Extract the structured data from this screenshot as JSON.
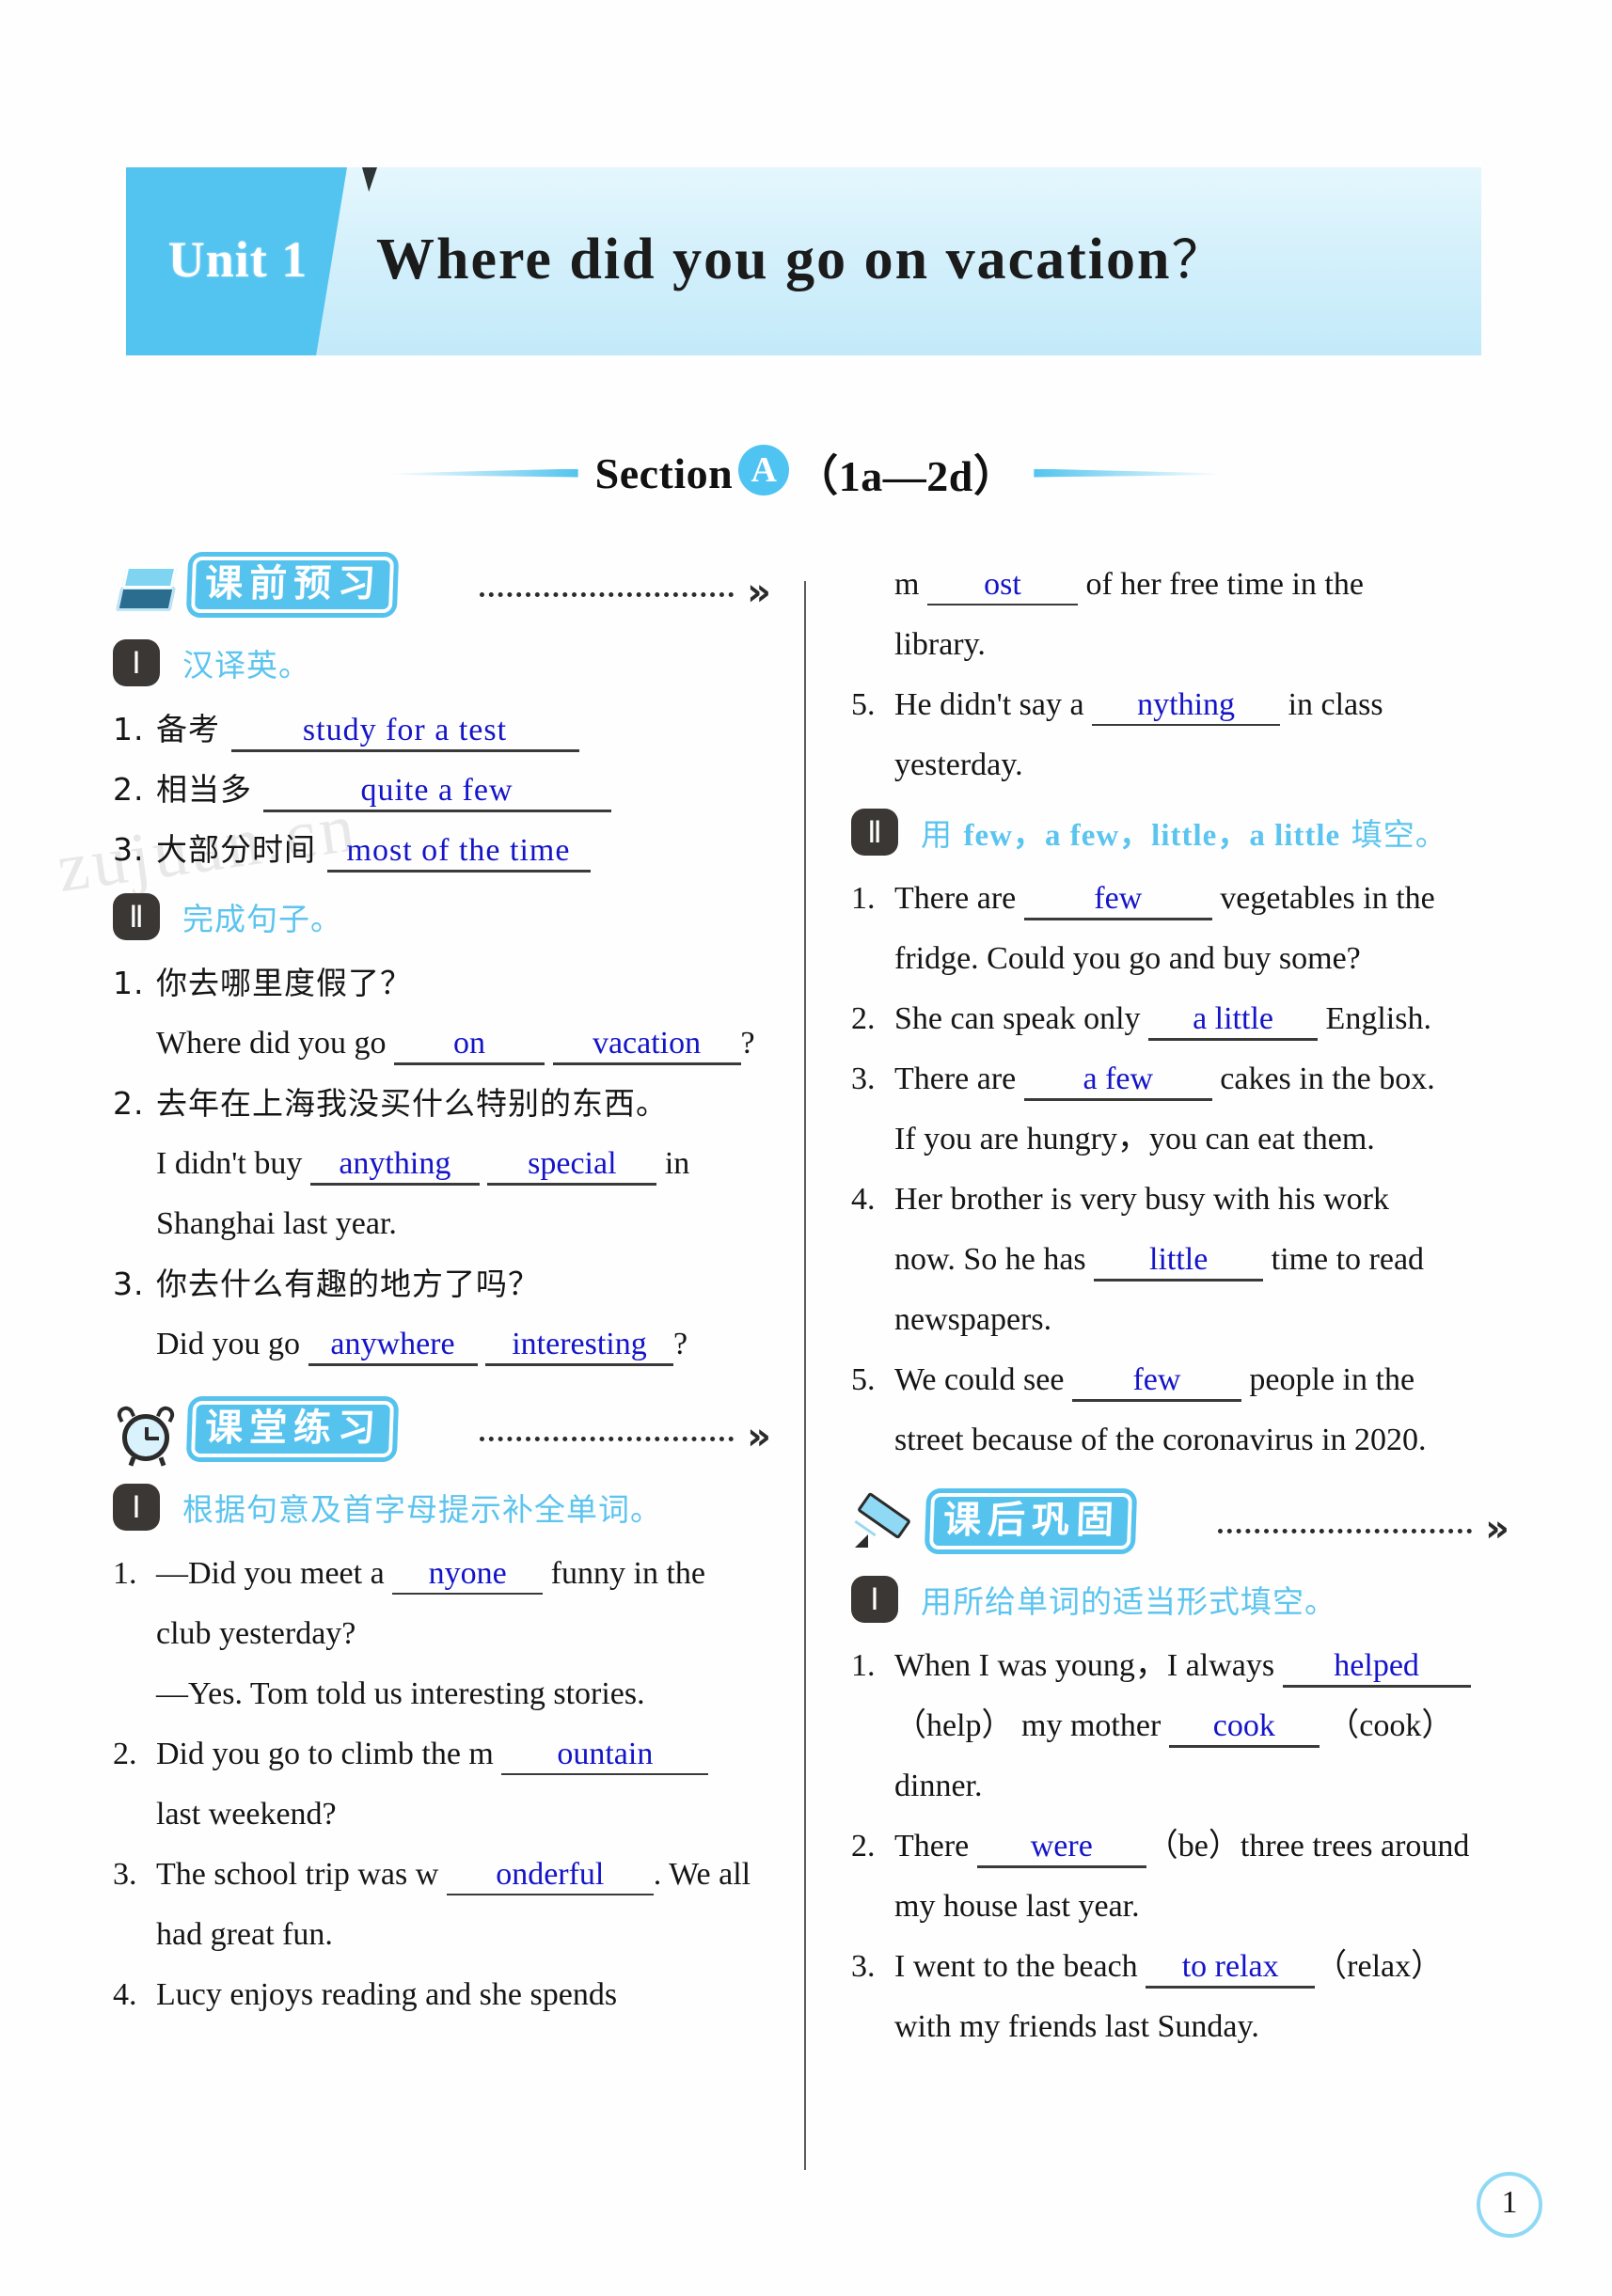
{
  "banner": {
    "unit_label": "Unit 1",
    "title": "Where did you go on vacation",
    "question_mark": "？"
  },
  "section_heading": {
    "prefix": "Section",
    "circle_letter": "A",
    "range": "（1a—2d）"
  },
  "watermark": "zujuan.cn",
  "page_number": "1",
  "left_column": {
    "blocks": [
      {
        "icon": "books-icon",
        "label": "课前预习",
        "exercises": [
          {
            "roman": "Ⅰ",
            "title": "汉译英。",
            "items": [
              {
                "num": "1.",
                "prompt": "备考",
                "answer": "study for a test"
              },
              {
                "num": "2.",
                "prompt": "相当多",
                "answer": "quite a few"
              },
              {
                "num": "3.",
                "prompt": "大部分时间",
                "answer": "most of the time"
              }
            ]
          },
          {
            "roman": "Ⅱ",
            "title": "完成句子。",
            "items": [
              {
                "num": "1.",
                "cn": "你去哪里度假了？",
                "line1_pre": "Where did you go",
                "answer1": "on",
                "answer2": "vacation",
                "line1_post": "?"
              },
              {
                "num": "2.",
                "cn": "去年在上海我没买什么特别的东西。",
                "line1_pre": "I didn't buy",
                "answer1": "anything",
                "answer2": "special",
                "line1_post": "in",
                "line2": "Shanghai last year."
              },
              {
                "num": "3.",
                "cn": "你去什么有趣的地方了吗？",
                "line1_pre": "Did you go",
                "answer1": "anywhere",
                "answer2": "interesting",
                "line1_post": "?"
              }
            ]
          }
        ]
      },
      {
        "icon": "clock-icon",
        "label": "课堂练习",
        "exercises": [
          {
            "roman": "Ⅰ",
            "title": "根据句意及首字母提示补全单词。",
            "items": [
              {
                "num": "1.",
                "line1_pre": "—Did you meet a",
                "hint": "",
                "answer": "nyone",
                "line1_post": "funny in the",
                "line2": "club yesterday?",
                "line3": "—Yes. Tom told us interesting stories."
              },
              {
                "num": "2.",
                "line1_pre": "Did you go to climb the m",
                "answer": "ountain",
                "line2": "last weekend?"
              },
              {
                "num": "3.",
                "line1_pre": "The school trip was w",
                "answer": "onderful",
                "line1_post": ". We all",
                "line2": "had great fun."
              },
              {
                "num": "4.",
                "line1_pre": "Lucy enjoys reading and she spends"
              }
            ]
          }
        ]
      }
    ]
  },
  "right_column": {
    "continued": {
      "line1_pre": "m",
      "answer": "ost",
      "line1_post": "of her free time in the",
      "line2": "library."
    },
    "continued_items": [
      {
        "num": "5.",
        "line1_pre": "He didn't say a",
        "answer": "nything",
        "line1_post": "in class",
        "line2": "yesterday."
      }
    ],
    "blocks": [
      {
        "roman": "Ⅱ",
        "title_cn": "用",
        "title_en": "few，a few，little，a little",
        "title_cn2": "填空。",
        "items": [
          {
            "num": "1.",
            "line1_pre": "There are",
            "answer": "few",
            "line1_post": "vegetables in the",
            "line2": "fridge. Could you go and buy some?"
          },
          {
            "num": "2.",
            "line1_pre": "She can speak only",
            "answer": "a little",
            "line1_post": "English."
          },
          {
            "num": "3.",
            "line1_pre": "There are",
            "answer": "a few",
            "line1_post": "cakes in the box.",
            "line2": "If you are hungry，you can eat them."
          },
          {
            "num": "4.",
            "line1_pre": "Her brother is very busy with his work",
            "line2_pre": "now. So he has",
            "answer": "little",
            "line2_post": "time to read",
            "line3": "newspapers."
          },
          {
            "num": "5.",
            "line1_pre": "We could see",
            "answer": "few",
            "line1_post": "people in the",
            "line2": "street because of the coronavirus in 2020."
          }
        ]
      }
    ],
    "consolidation": {
      "icon": "pencil-icon",
      "label": "课后巩固",
      "exercises": [
        {
          "roman": "Ⅰ",
          "title": "用所给单词的适当形式填空。",
          "items": [
            {
              "num": "1.",
              "line1_pre": "When I was young，I always",
              "answer1": "helped",
              "line2_pre": "（help） my mother",
              "answer2": "cook",
              "line2_post": "（cook）",
              "line3": "dinner."
            },
            {
              "num": "2.",
              "line1_pre": "There",
              "answer1": "were",
              "line1_post": "（be）three trees around",
              "line2": "my house last year."
            },
            {
              "num": "3.",
              "line1_pre": "I went to the beach",
              "answer1": "to relax",
              "line1_post": "（relax）",
              "line2": "with my friends last Sunday."
            }
          ]
        }
      ]
    }
  }
}
